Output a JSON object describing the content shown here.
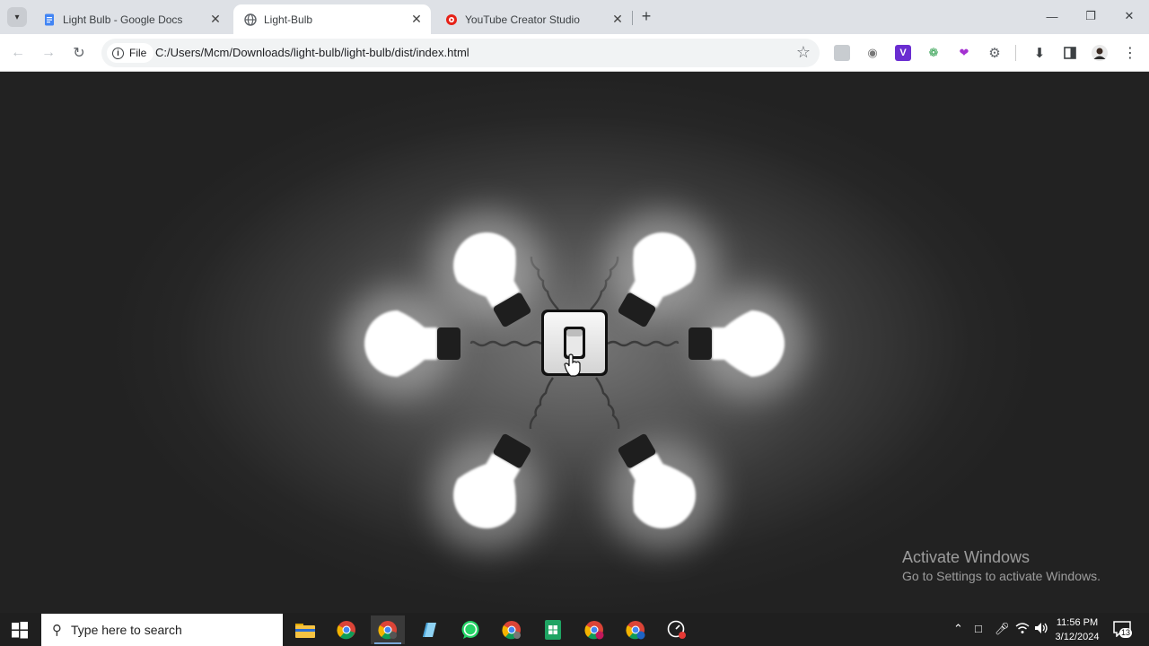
{
  "browser": {
    "tabs": [
      {
        "title": "Light Bulb - Google Docs",
        "favicon": "docs-icon",
        "active": false
      },
      {
        "title": "Light-Bulb",
        "favicon": "globe-icon",
        "active": true
      },
      {
        "title": "YouTube Creator Studio",
        "favicon": "youtube-studio-icon",
        "active": false
      }
    ],
    "new_tab": "+",
    "address": {
      "scheme_chip": "File",
      "url": "C:/Users/Mcm/Downloads/light-bulb/light-bulb/dist/index.html"
    }
  },
  "page": {
    "bulbs_lit": 6,
    "switch_state": "on"
  },
  "watermark": {
    "line1": "Activate Windows",
    "line2": "Go to Settings to activate Windows."
  },
  "taskbar": {
    "search_placeholder": "Type here to search",
    "time": "11:56 PM",
    "date": "3/12/2024",
    "notification_count": "13"
  },
  "colors": {
    "bulb_glow": "#ffffff",
    "bulb_base": "#1e1e1e",
    "background": "#222222",
    "accent_tab": "#ffffff",
    "chrome_frame": "#dee1e6"
  }
}
